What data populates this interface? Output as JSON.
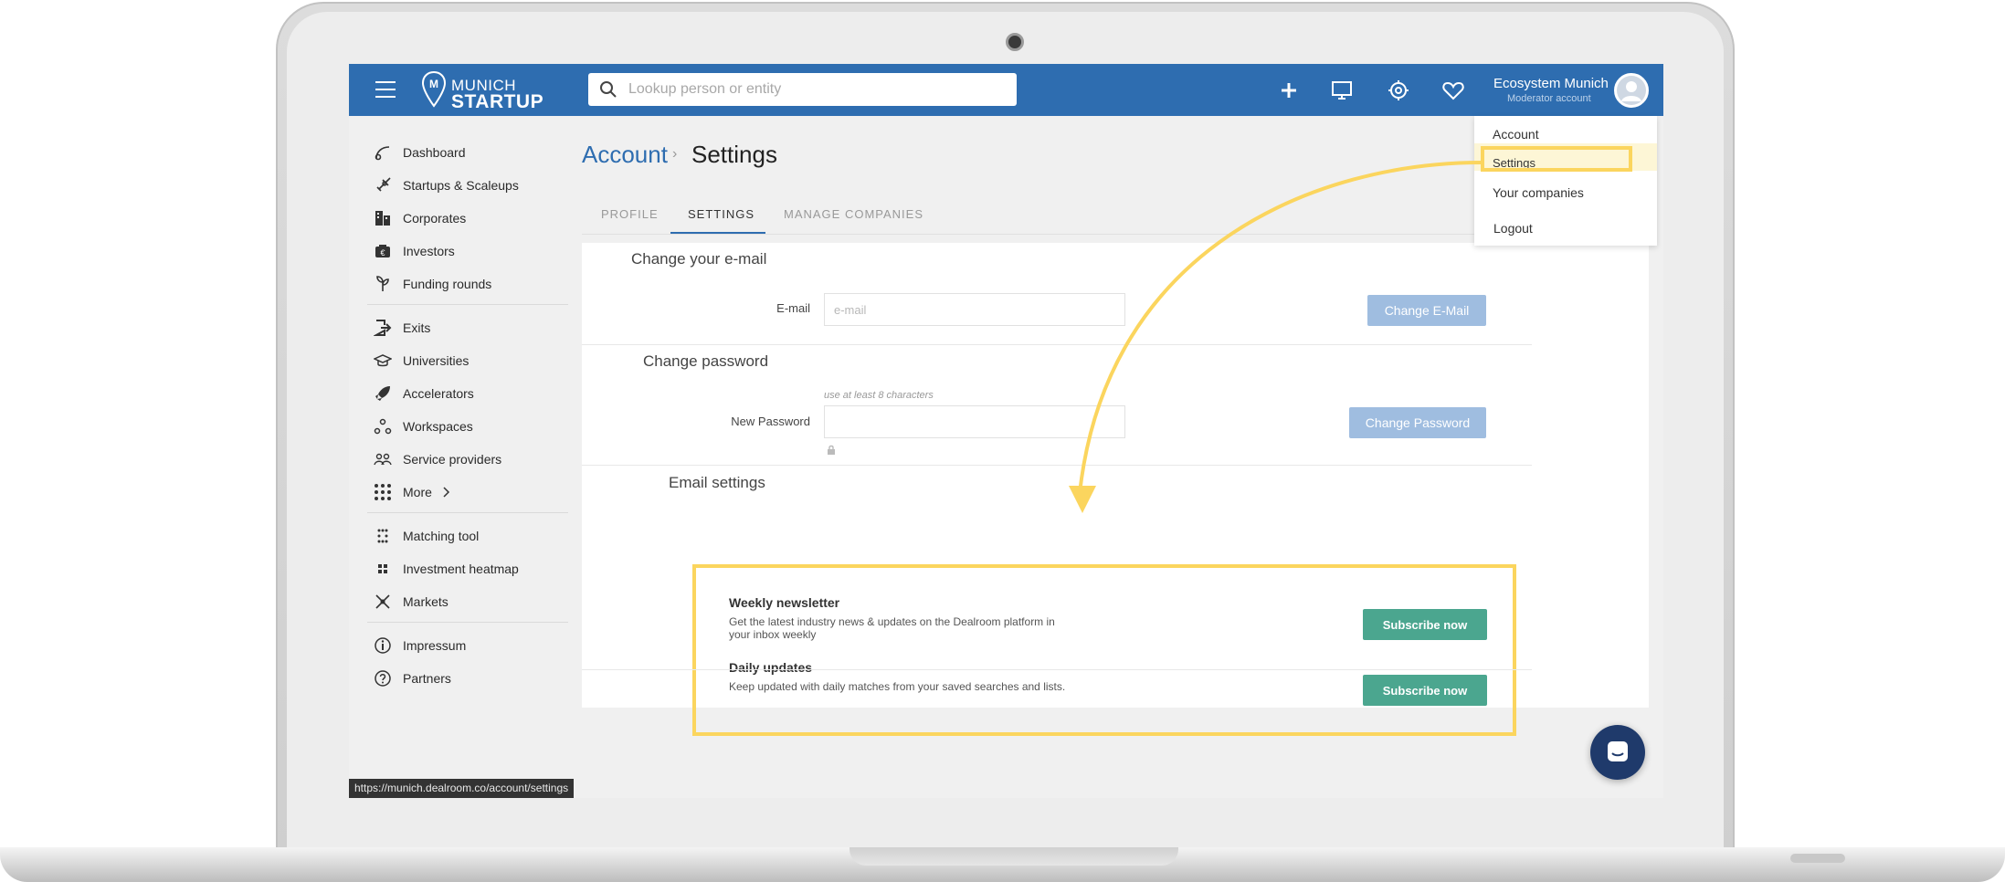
{
  "app": {
    "logo_top": "MUNICH",
    "logo_bottom": "STARTUP"
  },
  "search": {
    "placeholder": "Lookup person or entity"
  },
  "user": {
    "name": "Ecosystem Munich",
    "role": "Moderator account"
  },
  "dropdown": {
    "items": [
      "Account",
      "Settings",
      "Your companies",
      "Logout"
    ]
  },
  "sidebar": {
    "items": [
      "Dashboard",
      "Startups & Scaleups",
      "Corporates",
      "Investors",
      "Funding rounds",
      "Exits",
      "Universities",
      "Accelerators",
      "Workspaces",
      "Service providers",
      "More",
      "Matching tool",
      "Investment heatmap",
      "Markets",
      "Impressum",
      "Partners"
    ]
  },
  "status_url": "https://munich.dealroom.co/account/settings",
  "breadcrumb": {
    "parent": "Account",
    "separator": "›",
    "current": "Settings"
  },
  "tabs": [
    "PROFILE",
    "SETTINGS",
    "MANAGE COMPANIES"
  ],
  "email_section": {
    "title": "Change your e-mail",
    "label": "E-mail",
    "placeholder": "e-mail",
    "button": "Change E-Mail"
  },
  "password_section": {
    "title": "Change password",
    "hint": "use at least 8 characters",
    "label": "New Password",
    "button": "Change Password"
  },
  "email_settings": {
    "title": "Email settings",
    "items": [
      {
        "title": "Weekly newsletter",
        "description": "Get the latest industry news & updates on the Dealroom platform in your inbox weekly",
        "button": "Subscribe now"
      },
      {
        "title": "Daily updates",
        "description": "Keep updated with daily matches from your saved searches and lists.",
        "button": "Subscribe now"
      }
    ]
  },
  "colors": {
    "brand_blue": "#2e6db0",
    "highlight_yellow": "#fbd55e",
    "subscribe_green": "#4ba68f",
    "disabled_blue": "#9fbde0"
  }
}
